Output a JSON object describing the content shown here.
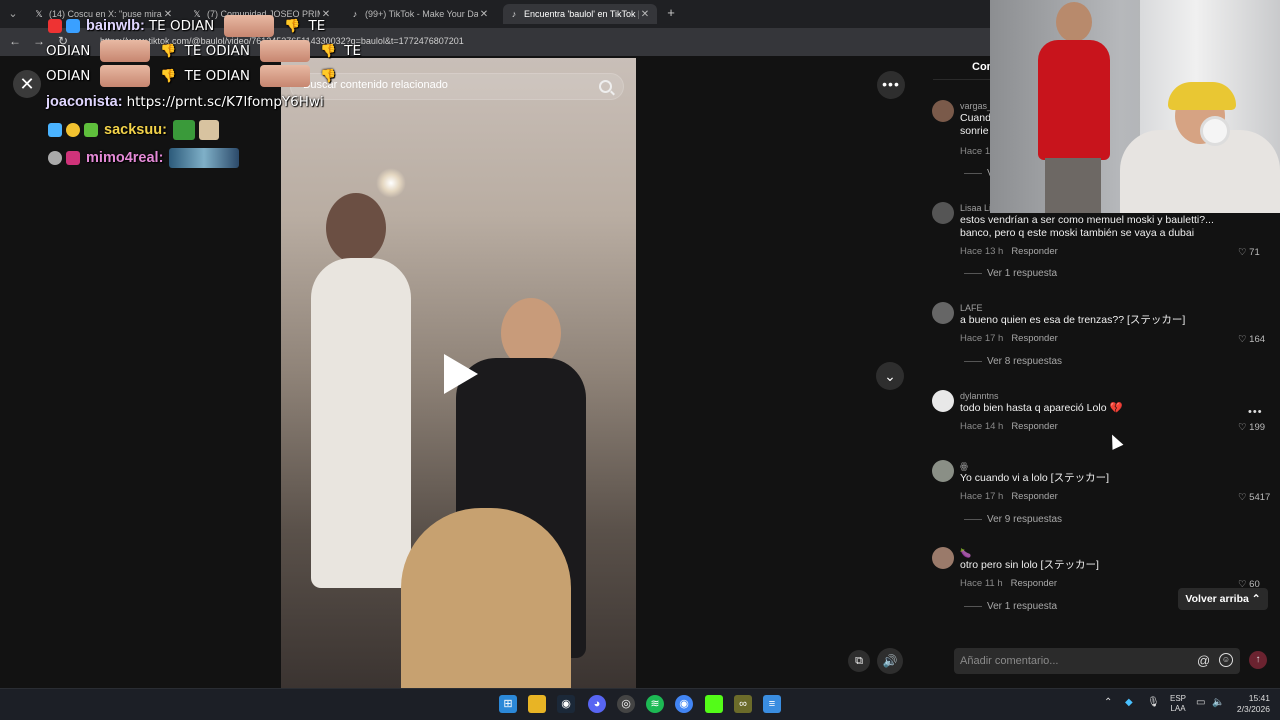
{
  "browser": {
    "tabs": [
      {
        "label": "(14) Coscu en X: \"puse mirar fi",
        "icon": "x-logo-icon",
        "active": false
      },
      {
        "label": "(7) Comunidad JOSEO PRIME (",
        "icon": "x-logo-icon",
        "active": false
      },
      {
        "label": "(99+) TikTok - Make Your Day",
        "icon": "tiktok-icon",
        "active": false
      },
      {
        "label": "Encuentra 'baulol' en TikTok | B",
        "icon": "tiktok-icon",
        "active": true
      }
    ],
    "close_glyph": "✕",
    "new_tab_glyph": "+",
    "url": "https://www.tiktok.com/@baulol/video/7612453765114330032?q=baulol&t=1772476807201"
  },
  "chat": {
    "lines": [
      {
        "user": "bainwlb:",
        "message": "TE ODIAN",
        "tail": "TE"
      },
      {
        "user": "",
        "message": "ODIAN",
        "tail": "TE ODIAN",
        "tail2": "TE"
      },
      {
        "user": "",
        "message": "ODIAN",
        "tail": "TE ODIAN",
        "tail2": ""
      },
      {
        "user": "joaconista:",
        "message": "https://prnt.sc/K7lfompY6Hwi"
      },
      {
        "user": "sacksuu:",
        "message": ""
      },
      {
        "user": "mimo4real:",
        "message": ""
      }
    ]
  },
  "video": {
    "search_placeholder": "Buscar contenido relacionado",
    "play_glyph": "▶",
    "more_glyph": "•••",
    "down_glyph": "⌄",
    "pip_glyph": "⧉",
    "volume_glyph": "🔊"
  },
  "comments": {
    "tab_label": "Com",
    "items": [
      {
        "user": "vargas_",
        "text": "Cuand… sonrie…",
        "time": "Hace 12",
        "reply": "",
        "likes": "",
        "replies": "V"
      },
      {
        "user": "Lisaa Li",
        "text": "estos vendrían a ser como memuel moski y bauletti?... banco, pero q este moski también se vaya a dubai",
        "time": "Hace 13 h",
        "reply": "Responder",
        "likes": "71",
        "replies": "Ver 1 respuesta"
      },
      {
        "user": "LAFE",
        "text": "a bueno quien es esa de trenzas?? [ステッカー]",
        "time": "Hace 17 h",
        "reply": "Responder",
        "likes": "164",
        "replies": "Ver 8 respuestas"
      },
      {
        "user": "dylanntns",
        "text": "todo bien hasta q apareció Lolo 💔",
        "time": "Hace 14 h",
        "reply": "Responder",
        "likes": "199",
        "replies": ""
      },
      {
        "user": "ꙮ",
        "text": "Yo cuando vi a lolo [ステッカー]",
        "time": "Hace 17 h",
        "reply": "Responder",
        "likes": "5417",
        "replies": "Ver 9 respuestas"
      },
      {
        "user": "🍆",
        "text": "otro pero sin lolo [ステッカー]",
        "time": "Hace 11 h",
        "reply": "Responder",
        "likes": "60",
        "replies": "Ver 1 respuesta"
      }
    ],
    "back_to_top": "Volver arriba",
    "input_placeholder": "Añadir comentario...",
    "at_glyph": "@",
    "emoji_glyph": "☺",
    "send_glyph": "↑",
    "heart_glyph": "♡",
    "more_glyph": "•••"
  },
  "taskbar": {
    "lang_line1": "ESP",
    "lang_line2": "LAA",
    "time": "15:41",
    "date": "2/3/2026"
  },
  "colors": {
    "background": "#121212",
    "tiktok_accent": "#fe2c55",
    "chat_name": "#e0d6ff"
  }
}
